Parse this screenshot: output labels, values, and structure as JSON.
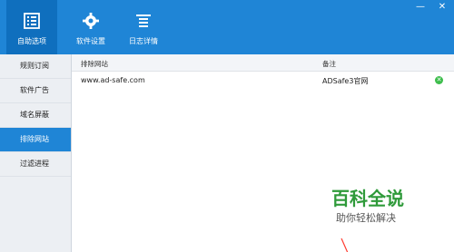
{
  "toolbar": {
    "items": [
      {
        "label": "自助选项",
        "icon": "checklist-icon",
        "active": true
      },
      {
        "label": "软件设置",
        "icon": "gear-icon",
        "active": false
      },
      {
        "label": "日志详情",
        "icon": "list-icon",
        "active": false
      }
    ],
    "window_controls": {
      "minimize": "—",
      "close": "✕"
    },
    "accent_color": "#1f85d6"
  },
  "sidebar": {
    "items": [
      {
        "label": "规则订阅",
        "active": false
      },
      {
        "label": "软件广告",
        "active": false
      },
      {
        "label": "域名屏蔽",
        "active": false
      },
      {
        "label": "排除网站",
        "active": true
      },
      {
        "label": "过滤进程",
        "active": false
      }
    ]
  },
  "table": {
    "headers": {
      "site": "排除网站",
      "note": "备注"
    },
    "rows": [
      {
        "site": "www.ad-safe.com",
        "note": "ADSafe3官网",
        "action_icon": "remove-icon"
      }
    ]
  },
  "watermark": {
    "title": "百科全说",
    "subtitle": "助你轻松解决"
  }
}
